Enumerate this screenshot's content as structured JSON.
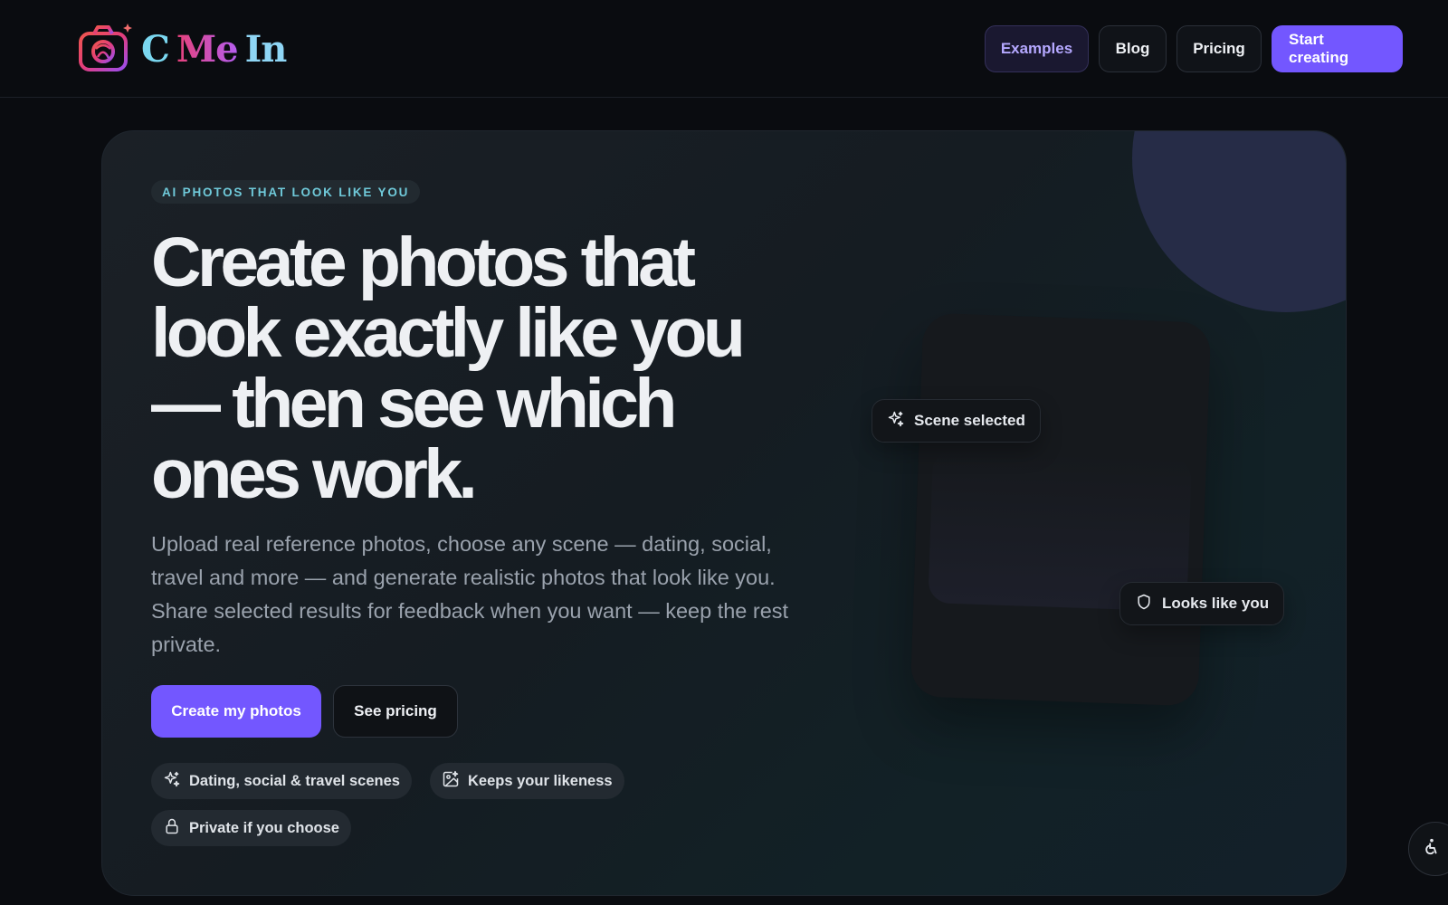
{
  "header": {
    "logo": {
      "part1": "C",
      "part2": "Me",
      "part3": "In",
      "icon": "camera-logo-icon"
    },
    "nav": [
      {
        "label": "Examples"
      },
      {
        "label": "Blog"
      },
      {
        "label": "Pricing"
      },
      {
        "label": "Start creating"
      }
    ]
  },
  "hero": {
    "badge": "AI PHOTOS THAT LOOK LIKE YOU",
    "headline": "Create photos that look exactly like you — then see which ones work.",
    "subtitle": "Upload real reference photos, choose any scene — dating, social, travel and more — and generate realistic photos that look like you. Share selected results for feedback when you want — keep the rest private.",
    "primary_cta": "Create my photos",
    "secondary_cta": "See pricing",
    "features": [
      {
        "label": "Dating, social & travel scenes",
        "icon": "sparkles-icon"
      },
      {
        "label": "Keeps your likeness",
        "icon": "image-sparkle-icon"
      },
      {
        "label": "Private if you choose",
        "icon": "lock-icon"
      }
    ],
    "preview": {
      "scene_chip": {
        "label": "Scene selected",
        "icon": "sparkles-icon"
      },
      "likeness_chip": {
        "label": "Looks like you",
        "icon": "shield-icon"
      }
    }
  },
  "accessibility": {
    "icon": "accessibility-icon"
  },
  "colors": {
    "accent": "#7357ff",
    "badge_text": "#6fc9d9",
    "background": "#0a0c10"
  }
}
